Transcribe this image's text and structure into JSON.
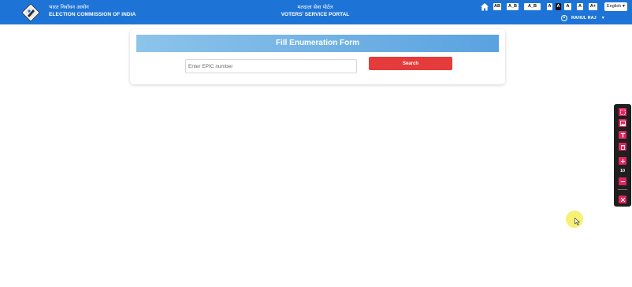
{
  "header": {
    "org_hindi": "भारत निर्वाचन आयोग",
    "org_english": "ELECTION COMMISSION OF INDIA",
    "portal_hindi": "मतदाता सेवा पोर्टल",
    "portal_english": "VOTERS' SERVICE PORTAL",
    "accessibility": {
      "contrast_label": "AB",
      "font_btn_1": "A_B",
      "font_btn_2": "A_B",
      "small": "A",
      "normal": "A",
      "spacing": "A",
      "large": "A",
      "larger": "A+"
    },
    "language_selected": "English",
    "user_name": "RAHUL RAJ"
  },
  "form": {
    "title": "Fill Enumeration Form",
    "epic_placeholder": "Enter EPIC number",
    "epic_value": "",
    "search_label": "Search"
  },
  "toolbar": {
    "font_size_value": "10",
    "buttons": [
      "select-area-icon",
      "image-icon",
      "text-icon",
      "delete-icon",
      "zoom-in-icon",
      "zoom-out-icon",
      "close-icon"
    ]
  },
  "colors": {
    "header_bg": "#1e74d6",
    "title_gradient_start": "#8cc4ea",
    "title_gradient_end": "#5aa2e0",
    "search_button": "#e53b3b",
    "toolbar_bg": "#1f1f1f",
    "toolbar_accent": "#e0245e"
  }
}
